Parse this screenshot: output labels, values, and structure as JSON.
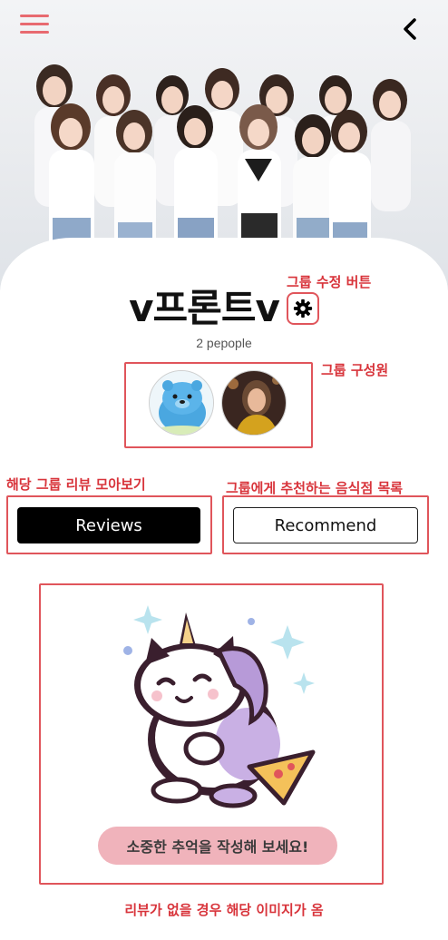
{
  "header": {
    "menu_icon": "hamburger-menu-icon",
    "back_icon": "chevron-left-icon"
  },
  "group": {
    "name": "v프론트v",
    "member_count": "2 pepople",
    "settings_icon": "gear-icon"
  },
  "members": [
    {
      "name": "member-blue-character",
      "avatar": "blue-bear-character"
    },
    {
      "name": "member-photo",
      "avatar": "person-photo"
    }
  ],
  "buttons": {
    "reviews": "Reviews",
    "recommend": "Recommend"
  },
  "empty_state": {
    "illustration": "unicorn-cat-eating-pizza",
    "message": "소중한 추억을 작성해 보세요!"
  },
  "annotations": {
    "edit_group": "그룹 수정 버튼",
    "members": "그룹 구성원",
    "reviews": "해당 그룹 리뷰 모아보기",
    "recommend": "그룹에게 추천하는 음식점 목록",
    "empty": "리뷰가 없을 경우 해당 이미지가 옴"
  },
  "colors": {
    "accent": "#e0555b",
    "annotation_text": "#d8343b",
    "menu_icon": "#e86a70",
    "pill_bg": "#f0b3bb",
    "primary_button": "#000000"
  }
}
